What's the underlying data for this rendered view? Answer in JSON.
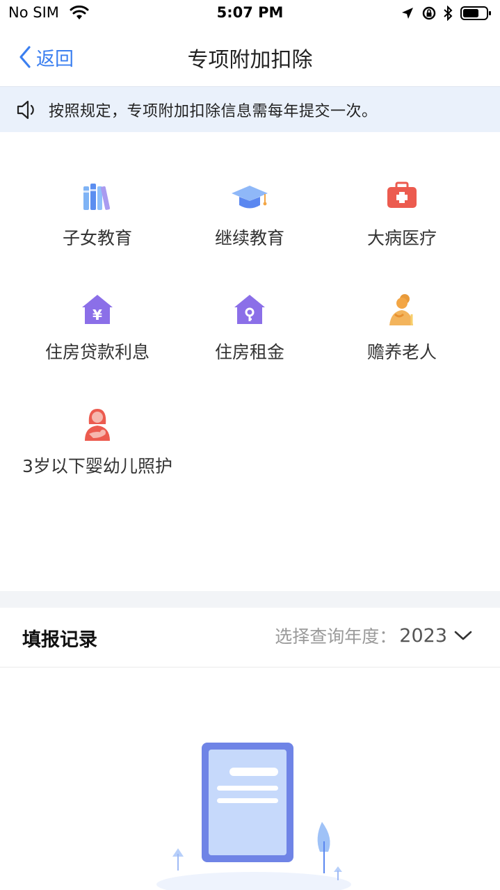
{
  "status_bar": {
    "carrier": "No SIM",
    "time": "5:07 PM",
    "icons": [
      "wifi-icon",
      "location-arrow-icon",
      "orientation-lock-icon",
      "bluetooth-icon",
      "battery-icon"
    ]
  },
  "nav": {
    "back_label": "返回",
    "title": "专项附加扣除"
  },
  "notice": {
    "icon": "speaker-icon",
    "text": "按照规定，专项附加扣除信息需每年提交一次。"
  },
  "deductions": [
    {
      "label": "子女教育",
      "icon": "books-icon"
    },
    {
      "label": "继续教育",
      "icon": "graduation-cap-icon"
    },
    {
      "label": "大病医疗",
      "icon": "medical-kit-icon"
    },
    {
      "label": "住房贷款利息",
      "icon": "house-yuan-icon"
    },
    {
      "label": "住房租金",
      "icon": "house-key-icon"
    },
    {
      "label": "赡养老人",
      "icon": "elderly-person-icon"
    },
    {
      "label": "3岁以下婴幼儿照护",
      "icon": "mother-baby-icon"
    }
  ],
  "records": {
    "title": "填报记录",
    "year_label": "选择查询年度：",
    "year_value": "2023",
    "empty_icon": "empty-document-illustration"
  },
  "colors": {
    "accent": "#3b7ff0",
    "notice_bg": "#eaf1fb",
    "purple": "#8b6fe8",
    "red": "#ec5b4f",
    "orange": "#f3a645"
  }
}
